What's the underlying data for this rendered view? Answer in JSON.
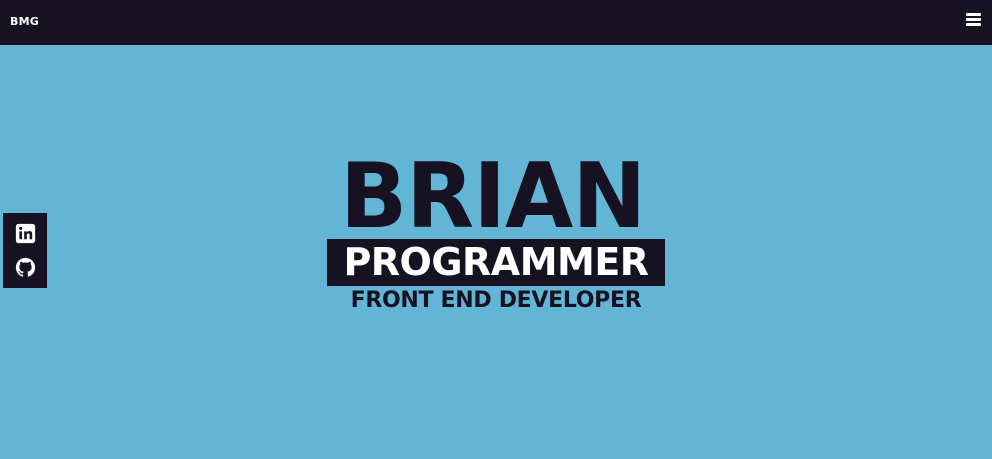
{
  "header": {
    "brand": "BMG",
    "menu_icon": "hamburger-menu-icon"
  },
  "social": {
    "links": [
      {
        "icon": "linkedin-icon",
        "label": "LinkedIn"
      },
      {
        "icon": "github-icon",
        "label": "GitHub"
      }
    ]
  },
  "hero": {
    "name": "BRIAN",
    "role": "PROGRAMMER",
    "subtitle": "FRONT END DEVELOPER"
  },
  "colors": {
    "background": "#63b5d6",
    "dark": "#171222",
    "light": "#ffffff"
  }
}
